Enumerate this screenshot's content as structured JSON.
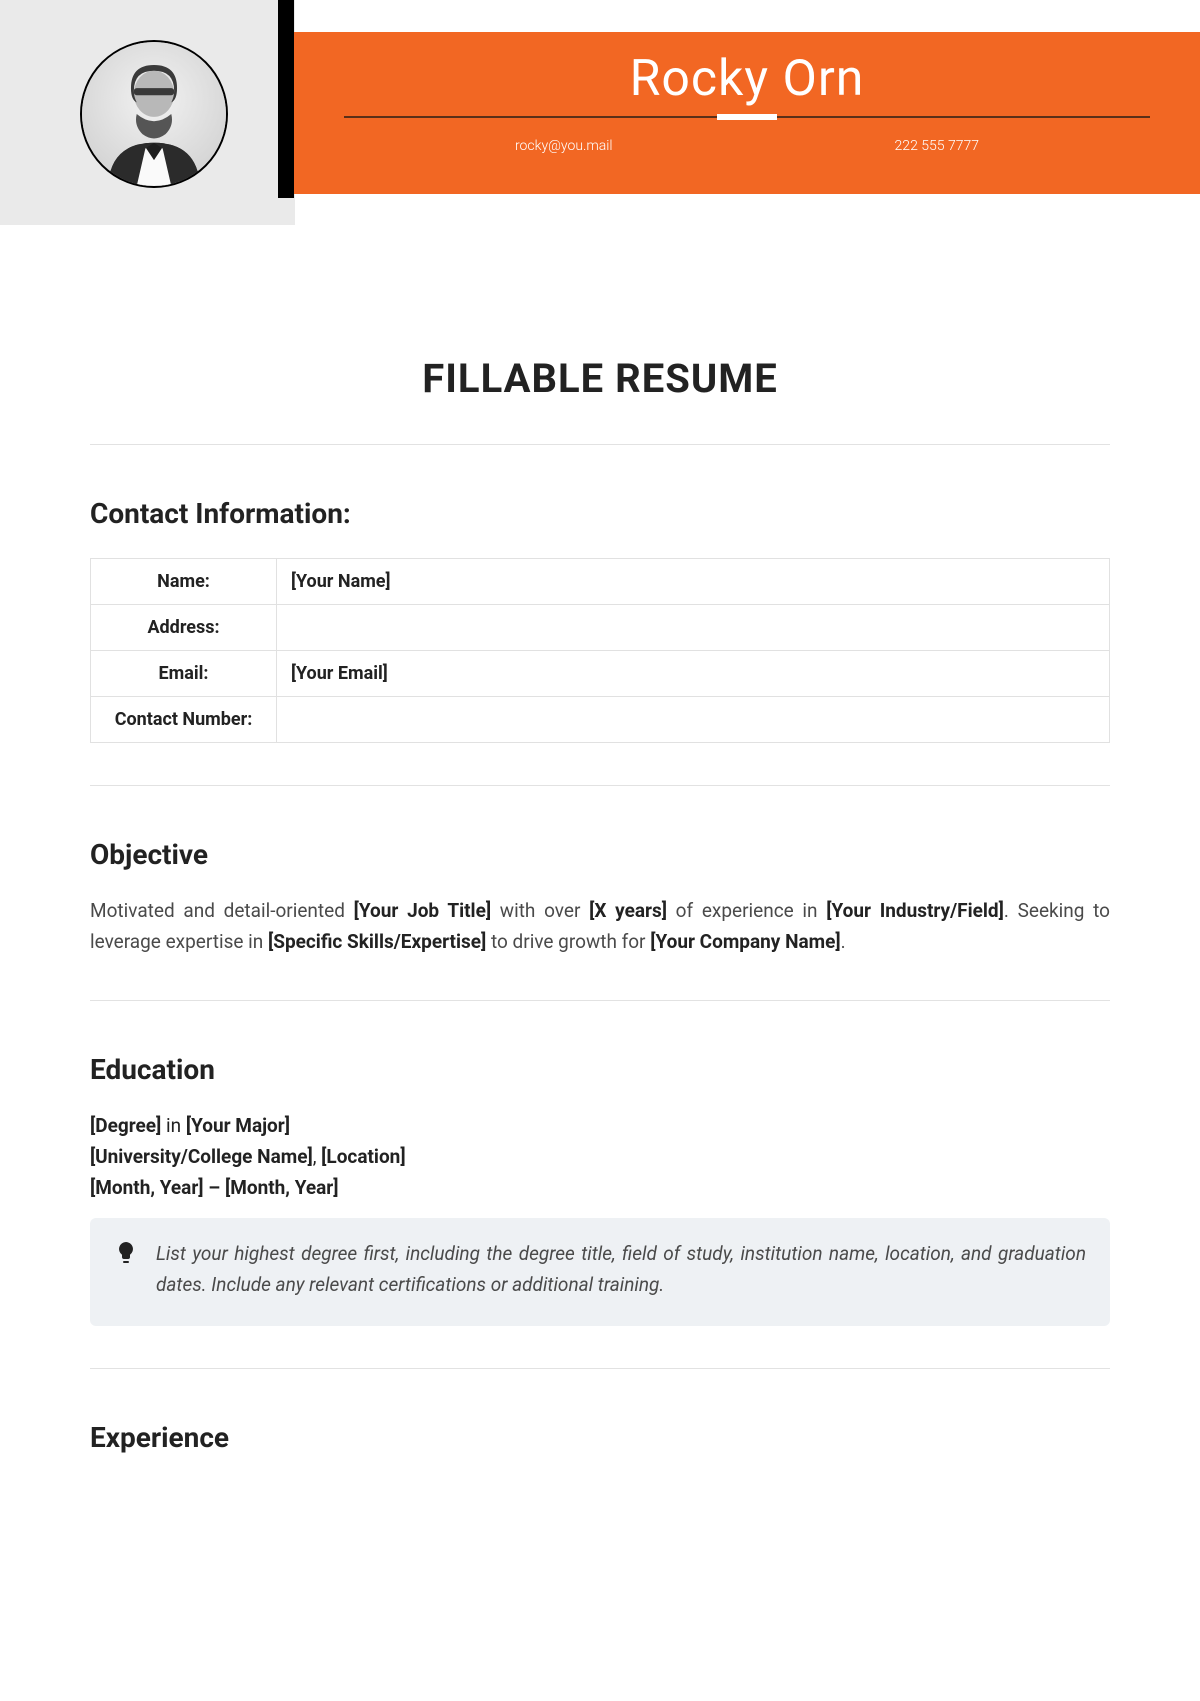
{
  "header": {
    "name": "Rocky Orn",
    "email": "rocky@you.mail",
    "phone": "222 555 7777"
  },
  "title": "FILLABLE RESUME",
  "sections": {
    "contact": {
      "heading": "Contact Information:",
      "rows": [
        {
          "label": "Name:",
          "value": "[Your Name]"
        },
        {
          "label": "Address:",
          "value": ""
        },
        {
          "label": "Email:",
          "value": "[Your Email]"
        },
        {
          "label": "Contact Number:",
          "value": ""
        }
      ]
    },
    "objective": {
      "heading": "Objective",
      "parts": {
        "p1": "Motivated and detail-oriented ",
        "b1": "[Your Job Title]",
        "p2": " with over ",
        "b2": "[X years]",
        "p3": " of experience in ",
        "b3": "[Your Industry/Field]",
        "p4": ". Seeking to leverage expertise in ",
        "b4": "[Specific Skills/Expertise]",
        "p5": " to drive growth for ",
        "b5": "[Your Company Name]",
        "p6": "."
      }
    },
    "education": {
      "heading": "Education",
      "line1": {
        "b1": "[Degree]",
        "t1": " in ",
        "b2": "[Your Major]"
      },
      "line2": {
        "b1": "[University/College Name]",
        "t1": ", ",
        "b2": "[Location]"
      },
      "line3": {
        "b1": "[Month, Year] – [Month, Year]"
      },
      "tip": "List your highest degree first, including the degree title, field of study, institution name, location, and graduation dates. Include any relevant certifications or additional training."
    },
    "experience": {
      "heading": "Experience"
    }
  }
}
